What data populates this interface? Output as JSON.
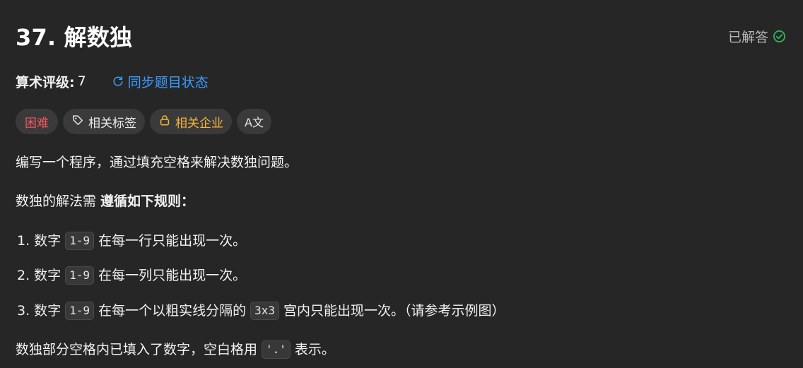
{
  "problem": {
    "title": "37. 解数独",
    "status_label": "已解答"
  },
  "meta": {
    "rating_label": "算术评级:",
    "rating_value": "7",
    "sync_label": "同步题目状态"
  },
  "tags": {
    "difficulty": "困难",
    "related_tags": "相关标签",
    "related_companies": "相关企业",
    "translate": "A文"
  },
  "description": {
    "p1": "编写一个程序，通过填充空格来解决数独问题。",
    "p2_prefix": "数独的解法需 ",
    "p2_bold": "遵循如下规则：",
    "rules": [
      {
        "num": "1.",
        "prefix": "数字",
        "code": "1-9",
        "suffix": "在每一行只能出现一次。"
      },
      {
        "num": "2.",
        "prefix": "数字",
        "code": "1-9",
        "suffix": "在每一列只能出现一次。"
      },
      {
        "num": "3.",
        "prefix": "数字",
        "code": "1-9",
        "middle": "在每一个以粗实线分隔的",
        "code2": "3x3",
        "suffix": "宫内只能出现一次。（请参考示例图）"
      }
    ],
    "p3_prefix": "数独部分空格内已填入了数字，空白格用",
    "p3_code": "'.'",
    "p3_suffix": "表示。"
  },
  "colors": {
    "background": "#262626",
    "accent_blue": "#3a9cff",
    "difficulty_red": "#f0575d",
    "company_yellow": "#f2b33a",
    "solved_green": "#2cbb5d"
  },
  "icons": {
    "solved": "check-circle-icon",
    "sync": "refresh-icon",
    "tag": "tag-icon",
    "lock": "lock-icon"
  }
}
